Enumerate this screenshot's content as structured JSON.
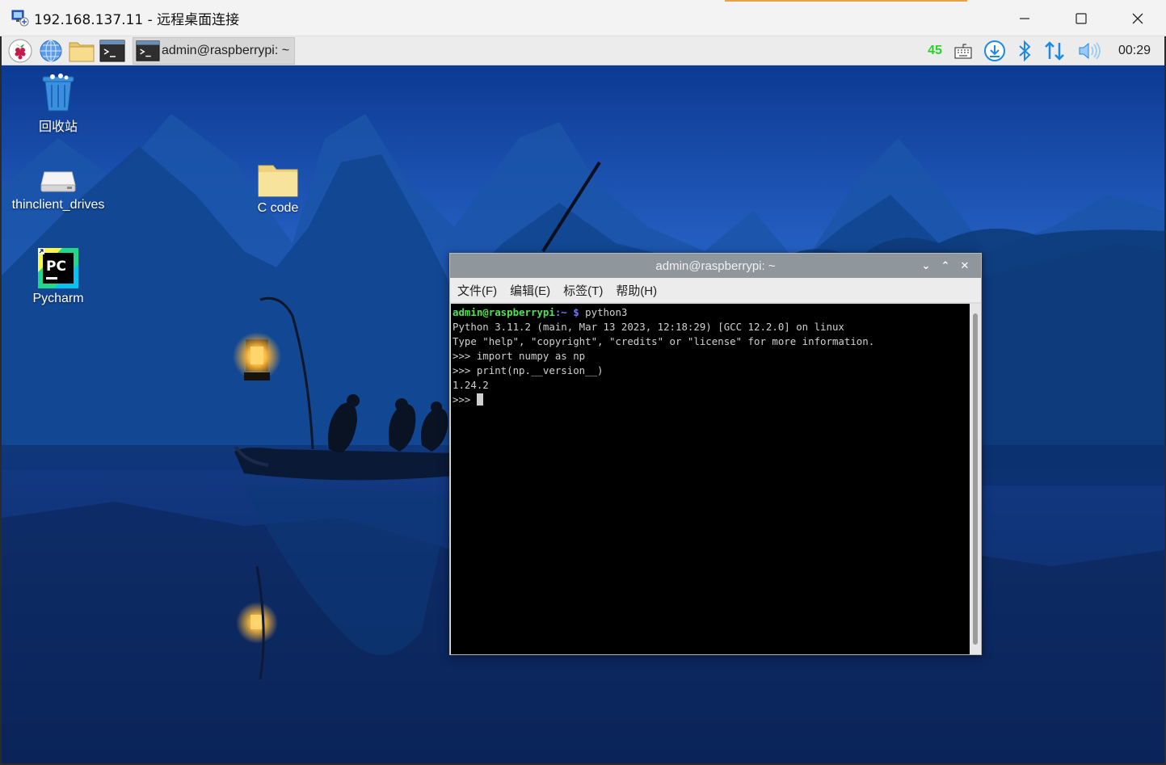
{
  "window": {
    "title": "192.168.137.11 - 远程桌面连接",
    "controls": [
      "minimize-icon",
      "maximize-icon",
      "close-icon"
    ]
  },
  "taskbar": {
    "launchers": [
      "raspberry-menu-icon",
      "web-browser-icon",
      "file-manager-icon",
      "terminal-icon"
    ],
    "active_task_label": "admin@raspberrypi: ~",
    "tray": {
      "cpu_value": "45",
      "clock": "00:29",
      "icons": [
        "keyboard-icon",
        "download-icon",
        "bluetooth-icon",
        "network-icon",
        "volume-icon"
      ],
      "cpu_color": "#2bd12b"
    }
  },
  "desktop": {
    "icons": [
      {
        "label": "回收站",
        "icon": "trash-icon"
      },
      {
        "label": "thinclient_drives",
        "icon": "drive-icon"
      },
      {
        "label": "C code",
        "icon": "folder-icon"
      },
      {
        "label": "Pycharm",
        "icon": "pycharm-icon"
      }
    ]
  },
  "terminal": {
    "title": "admin@raspberrypi: ~",
    "menu": [
      "文件(F)",
      "编辑(E)",
      "标签(T)",
      "帮助(H)"
    ],
    "prompt_user": "admin@raspberrypi",
    "prompt_sep": ":~ ",
    "prompt_symbol": "$",
    "command": " python3",
    "lines": [
      "Python 3.11.2 (main, Mar 13 2023, 12:18:29) [GCC 12.2.0] on linux",
      "Type \"help\", \"copyright\", \"credits\" or \"license\" for more information.",
      ">>> import numpy as np",
      ">>> print(np.__version__)",
      "1.24.2"
    ],
    "current_prompt": ">>> "
  }
}
